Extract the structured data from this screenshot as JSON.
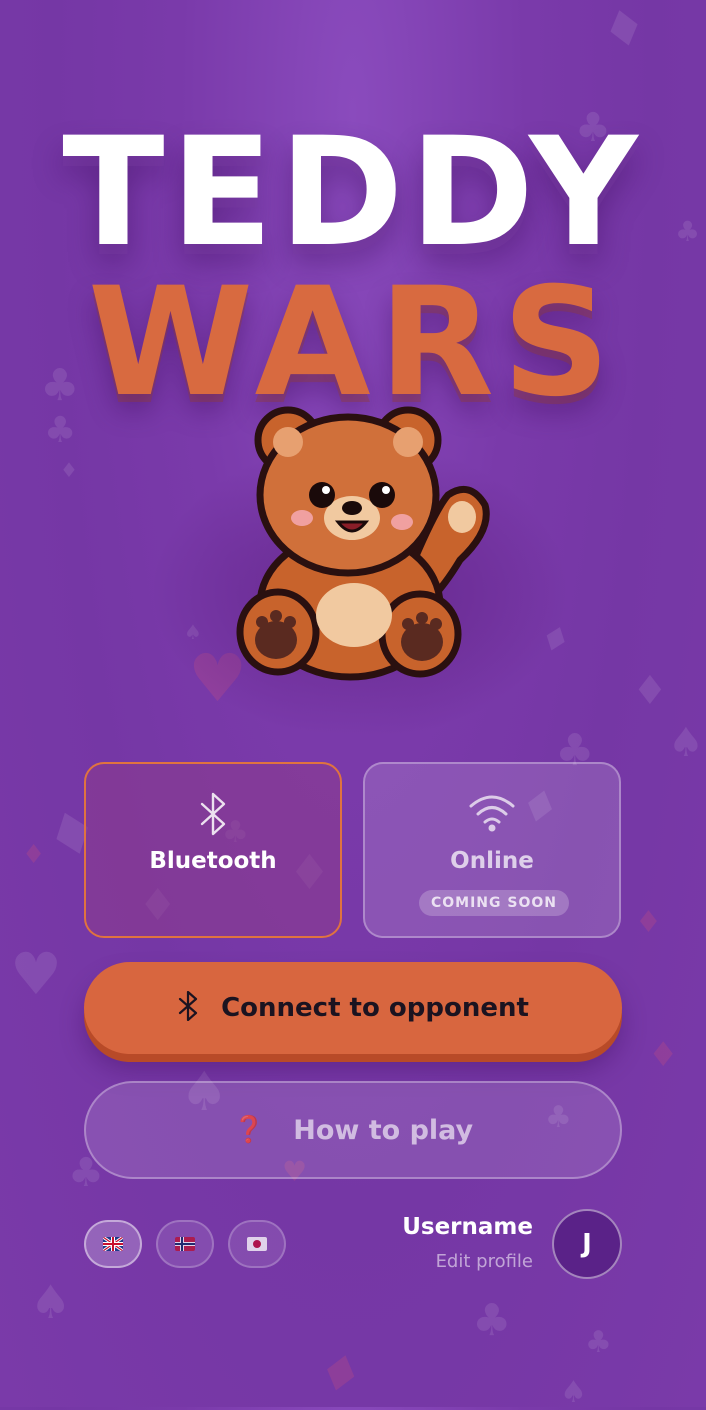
{
  "app": {
    "title_line1": "TEDDY",
    "title_line2": "WARS"
  },
  "modes": {
    "bluetooth": {
      "label": "Bluetooth",
      "icon": "bluetooth-icon",
      "selected": true
    },
    "online": {
      "label": "Online",
      "icon": "wifi-icon",
      "badge": "COMING SOON",
      "selected": false
    }
  },
  "actions": {
    "connect_label": "Connect to opponent",
    "connect_icon": "bluetooth-icon",
    "how_to_play_label": "How to play",
    "how_to_play_icon": "❓"
  },
  "languages": [
    {
      "name": "english-flag",
      "active": true
    },
    {
      "name": "norwegian-flag",
      "active": false
    },
    {
      "name": "japanese-flag",
      "active": false
    }
  ],
  "profile": {
    "username": "Username",
    "edit_label": "Edit profile",
    "avatar_initial": "J"
  },
  "colors": {
    "background": "#7a3aaa",
    "accent_orange": "#d8663f",
    "title_white": "#ffffff",
    "avatar_bg": "#5a2288"
  }
}
